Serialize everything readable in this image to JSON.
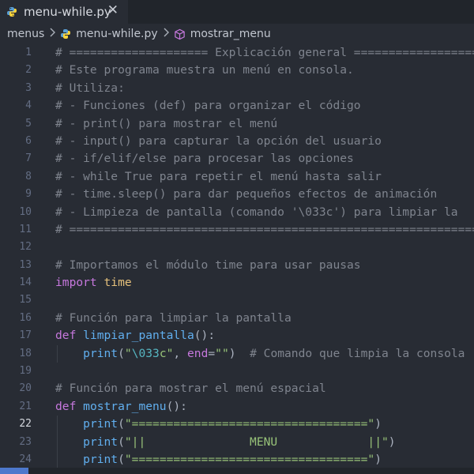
{
  "tab": {
    "title": "menu-while.py",
    "close": "✕"
  },
  "breadcrumb": {
    "folder": "menus",
    "file": "menu-while.py",
    "symbol": "mostrar_menu"
  },
  "editor": {
    "active_line": 22,
    "lines": [
      {
        "n": "1",
        "t": [
          [
            "c",
            "# ==================== Explicación general ==================="
          ]
        ]
      },
      {
        "n": "2",
        "t": [
          [
            "c",
            "# Este programa muestra un menú en consola."
          ]
        ]
      },
      {
        "n": "3",
        "t": [
          [
            "c",
            "# Utiliza:"
          ]
        ]
      },
      {
        "n": "4",
        "t": [
          [
            "c",
            "# - Funciones (def) para organizar el código"
          ]
        ]
      },
      {
        "n": "5",
        "t": [
          [
            "c",
            "# - print() para mostrar el menú"
          ]
        ]
      },
      {
        "n": "6",
        "t": [
          [
            "c",
            "# - input() para capturar la opción del usuario"
          ]
        ]
      },
      {
        "n": "7",
        "t": [
          [
            "c",
            "# - if/elif/else para procesar las opciones"
          ]
        ]
      },
      {
        "n": "8",
        "t": [
          [
            "c",
            "# - while True para repetir el menú hasta salir"
          ]
        ]
      },
      {
        "n": "9",
        "t": [
          [
            "c",
            "# - time.sleep() para dar pequeños efectos de animación"
          ]
        ]
      },
      {
        "n": "10",
        "t": [
          [
            "c",
            "# - Limpieza de pantalla (comando '\\033c') para limpiar la"
          ]
        ]
      },
      {
        "n": "11",
        "t": [
          [
            "c",
            "# ==========================================================="
          ]
        ]
      },
      {
        "n": "12",
        "t": []
      },
      {
        "n": "13",
        "t": [
          [
            "c",
            "# Importamos el módulo time para usar pausas"
          ]
        ]
      },
      {
        "n": "14",
        "t": [
          [
            "k",
            "import"
          ],
          [
            "p",
            " "
          ],
          [
            "b",
            "time"
          ]
        ]
      },
      {
        "n": "15",
        "t": []
      },
      {
        "n": "16",
        "t": [
          [
            "c",
            "# Función para limpiar la pantalla"
          ]
        ]
      },
      {
        "n": "17",
        "t": [
          [
            "k",
            "def"
          ],
          [
            "p",
            " "
          ],
          [
            "f",
            "limpiar_pantalla"
          ],
          [
            "p",
            "():"
          ]
        ]
      },
      {
        "n": "18",
        "t": [
          [
            "p",
            "    "
          ],
          [
            "f",
            "print"
          ],
          [
            "p",
            "("
          ],
          [
            "s",
            "\""
          ],
          [
            "e",
            "\\033"
          ],
          [
            "s",
            "c\""
          ],
          [
            "p",
            ", "
          ],
          [
            "k",
            "end"
          ],
          [
            "p",
            "="
          ],
          [
            "s",
            "\"\""
          ],
          [
            "p",
            ")  "
          ],
          [
            "c",
            "# Comando que limpia la consola"
          ]
        ]
      },
      {
        "n": "19",
        "t": []
      },
      {
        "n": "20",
        "t": [
          [
            "c",
            "# Función para mostrar el menú espacial"
          ]
        ]
      },
      {
        "n": "21",
        "t": [
          [
            "k",
            "def"
          ],
          [
            "p",
            " "
          ],
          [
            "f",
            "mostrar_menu"
          ],
          [
            "p",
            "():"
          ]
        ]
      },
      {
        "n": "22",
        "t": [
          [
            "p",
            "    "
          ],
          [
            "f",
            "print"
          ],
          [
            "p",
            "("
          ],
          [
            "s",
            "\"==================================\""
          ],
          [
            "p",
            ")"
          ]
        ]
      },
      {
        "n": "23",
        "t": [
          [
            "p",
            "    "
          ],
          [
            "f",
            "print"
          ],
          [
            "p",
            "("
          ],
          [
            "s",
            "\"||               MENU             ||\""
          ],
          [
            "p",
            ")"
          ]
        ]
      },
      {
        "n": "24",
        "t": [
          [
            "p",
            "    "
          ],
          [
            "f",
            "print"
          ],
          [
            "p",
            "("
          ],
          [
            "s",
            "\"==================================\""
          ],
          [
            "p",
            ")"
          ]
        ]
      }
    ]
  },
  "colors": {
    "background": "#282c34",
    "tabbar": "#21252b",
    "accent": "#4d78cc"
  },
  "icons": {
    "python": "python-icon",
    "close": "close-icon",
    "chevron": "chevron-right-icon",
    "symbol": "cube-icon"
  }
}
